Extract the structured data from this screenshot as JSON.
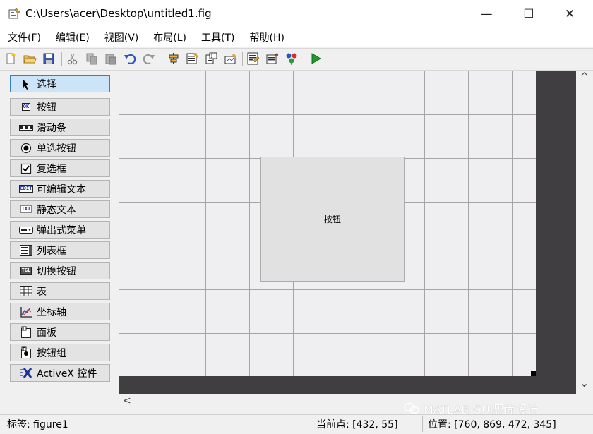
{
  "window": {
    "title": "C:\\Users\\acer\\Desktop\\untitled1.fig",
    "minimize_glyph": "—",
    "maximize_glyph": "☐",
    "close_glyph": "✕"
  },
  "menu": [
    "文件(F)",
    "编辑(E)",
    "视图(V)",
    "布局(L)",
    "工具(T)",
    "帮助(H)"
  ],
  "toolbar": {
    "icons": [
      "new-file-icon",
      "open-folder-icon",
      "save-icon",
      "cut-icon",
      "copy-icon",
      "paste-icon",
      "undo-icon",
      "redo-icon",
      "align-objects-icon",
      "menu-editor-icon",
      "tab-order-icon",
      "toolbar-editor-icon",
      "editor-icon",
      "property-inspector-icon",
      "object-browser-icon",
      "run-icon"
    ]
  },
  "palette": {
    "items": [
      {
        "label": "选择",
        "icon": "select-arrow-icon",
        "selected": true
      },
      {
        "label": "按钮",
        "icon": "push-button-icon",
        "icon_text": "OK"
      },
      {
        "label": "滑动条",
        "icon": "slider-icon"
      },
      {
        "label": "单选按钮",
        "icon": "radio-button-icon"
      },
      {
        "label": "复选框",
        "icon": "checkbox-icon"
      },
      {
        "label": "可编辑文本",
        "icon": "edit-text-icon",
        "icon_text": "EDIT"
      },
      {
        "label": "静态文本",
        "icon": "static-text-icon",
        "icon_text": "TXT"
      },
      {
        "label": "弹出式菜单",
        "icon": "popup-menu-icon"
      },
      {
        "label": "列表框",
        "icon": "listbox-icon"
      },
      {
        "label": "切换按钮",
        "icon": "toggle-button-icon",
        "icon_text": "TGL"
      },
      {
        "label": "表",
        "icon": "table-icon"
      },
      {
        "label": "坐标轴",
        "icon": "axes-icon"
      },
      {
        "label": "面板",
        "icon": "panel-icon"
      },
      {
        "label": "按钮组",
        "icon": "button-group-icon"
      },
      {
        "label": "ActiveX 控件",
        "icon": "activex-icon"
      }
    ]
  },
  "canvas": {
    "button_label": "按钮",
    "background": "#efeef0",
    "grid_color": "#a7a4a8"
  },
  "scroll": {
    "up_glyph": "^",
    "down_glyph": "⌄",
    "left_glyph": "<"
  },
  "status": {
    "tag": "标签: figure1",
    "current_point": "当前点:  [432, 55]",
    "position": "位置: [760, 869, 472, 345]"
  },
  "watermark": "MATLAB GUI界面设计",
  "colors": {
    "selected_palette_bg": "#cce4f7",
    "dark_area": "#403e40",
    "run_green": "#1f9a2c"
  }
}
